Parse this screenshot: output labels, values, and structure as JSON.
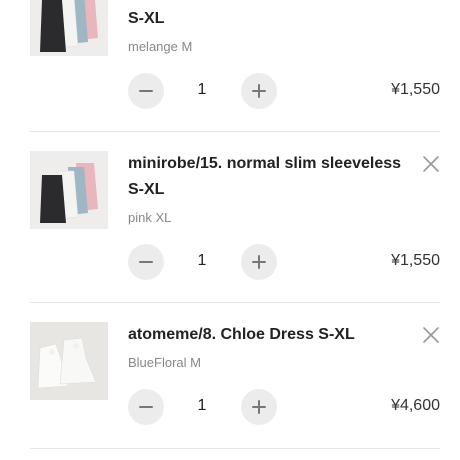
{
  "cart_items": [
    {
      "name": "S-XL",
      "variant": "melange M",
      "quantity": "1",
      "price": "¥1,550",
      "thumbnail_icon": "camisole-set-photo-icon"
    },
    {
      "name": "minirobe/15. normal slim sleeveless S-XL",
      "variant": "pink XL",
      "quantity": "1",
      "price": "¥1,550",
      "thumbnail_icon": "camisole-set-photo-icon"
    },
    {
      "name": "atomeme/8. Chloe Dress S-XL",
      "variant": "BlueFloral M",
      "quantity": "1",
      "price": "¥4,600",
      "thumbnail_icon": "white-dress-photo-icon"
    }
  ],
  "icons": {
    "remove": "close-icon",
    "decrement": "minus-icon",
    "increment": "plus-icon"
  },
  "colors": {
    "text": "#222222",
    "muted_text": "#888888",
    "button_bg": "#ececec",
    "divider": "#e6e6e6"
  }
}
